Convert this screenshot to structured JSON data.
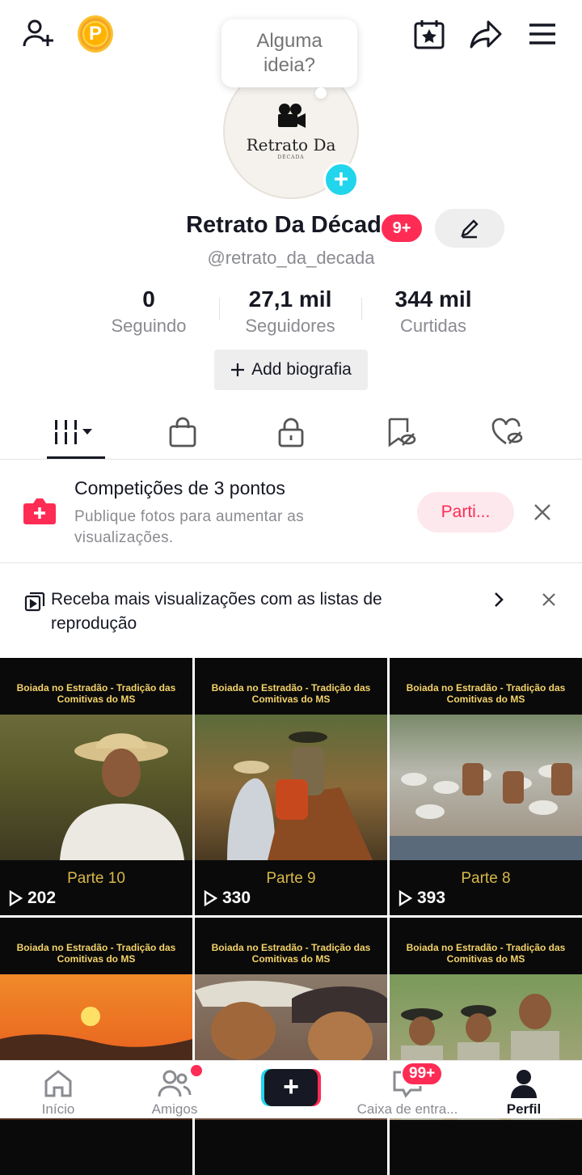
{
  "colors": {
    "accent": "#fe2c55",
    "cyan": "#20d5ec",
    "text": "#161823",
    "muted": "#8a8b91"
  },
  "header": {
    "bubble": "Alguma ideia?",
    "avatar_logo": "Retrato Da",
    "avatar_sub": "DÉCADA"
  },
  "profile": {
    "name": "Retrato Da Década",
    "notif_badge": "9+",
    "handle": "@retrato_da_decada",
    "add_bio": "Add biografia"
  },
  "stats": [
    {
      "value": "0",
      "label": "Seguindo"
    },
    {
      "value": "27,1 mil",
      "label": "Seguidores"
    },
    {
      "value": "344 mil",
      "label": "Curtidas"
    }
  ],
  "tabs": [
    "videos-grid-icon",
    "shopping-bag-icon",
    "lock-icon",
    "bookmark-eye-icon",
    "heart-eye-icon"
  ],
  "promo": {
    "title": "Competições de 3 pontos",
    "desc": "Publique fotos para aumentar as visualizações.",
    "button": "Parti..."
  },
  "playlist": {
    "text": "Receba mais visualizações com as listas de reprodução"
  },
  "videos": [
    {
      "caption": "Boiada no Estradão - Tradição das Comitivas do MS",
      "part": "Parte 10",
      "views": "202"
    },
    {
      "caption": "Boiada no Estradão - Tradição das Comitivas do MS",
      "part": "Parte 9",
      "views": "330"
    },
    {
      "caption": "Boiada no Estradão - Tradição das Comitivas do MS",
      "part": "Parte 8",
      "views": "393"
    },
    {
      "caption": "Boiada no Estradão - Tradição das Comitivas do MS",
      "part": "",
      "views": ""
    },
    {
      "caption": "Boiada no Estradão - Tradição das Comitivas do MS",
      "part": "",
      "views": ""
    },
    {
      "caption": "Boiada no Estradão - Tradição das Comitivas do MS",
      "part": "",
      "views": ""
    }
  ],
  "nav": {
    "home": "Início",
    "friends": "Amigos",
    "inbox": "Caixa de entra...",
    "inbox_badge": "99+",
    "profile": "Perfil"
  }
}
